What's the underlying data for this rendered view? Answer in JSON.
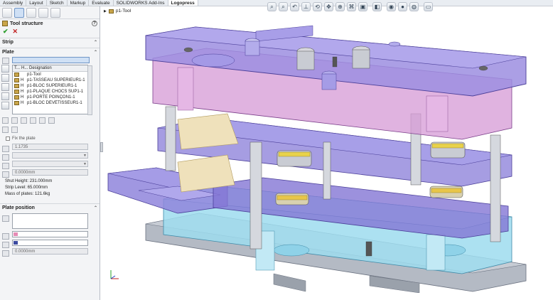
{
  "ribbon": {
    "tabs": [
      "Assembly",
      "Layout",
      "Sketch",
      "Markup",
      "Evaluate",
      "SOLIDWORKS Add-Ins",
      "Logopress"
    ],
    "active_tab": "Logopress"
  },
  "property_manager": {
    "title": "Tool structure",
    "help_icon": "?",
    "ok_icon": "✔",
    "cancel_icon": "✕",
    "group_strip": "Strip",
    "group_plate": "Plate",
    "table_headers": [
      "T...",
      "H...",
      "Designation"
    ],
    "rows": [
      {
        "h": "",
        "name": "p1-Tool"
      },
      {
        "h": "H",
        "name": "p1-TASSEAU SUPÉRIEUR1-1"
      },
      {
        "h": "H",
        "name": "p1-BLOC SUPÉRIEUR1-1"
      },
      {
        "h": "H",
        "name": "p1-PLAQUE CHOCS SUP1-1"
      },
      {
        "h": "H",
        "name": "p1-PORTE POINÇON1-1"
      },
      {
        "h": "H",
        "name": "p1-BLOC DÉVÊTISSEUR1-1"
      }
    ],
    "fix_plate_label": "Fix the plate",
    "field_value": "1.1735",
    "shut_height": "Shut Height: 231.000mm",
    "strip_level": "Strip Level: 65.000mm",
    "mass": "Mass of plates: 121.6kg",
    "spin_value": "0.0000mm",
    "group_plate_position": "Plate position",
    "bottom_value": "0.0000mm",
    "swatch1": "#e58bb5",
    "swatch2": "#3b4aa0"
  },
  "feature_tree": {
    "root": "p1-Tool"
  },
  "colors": {
    "purple": "#8f7ad6",
    "pink": "#d59ad6",
    "cyan": "#8fd2e8",
    "gray": "#a9b0bb",
    "gold": "#d8b84a"
  }
}
